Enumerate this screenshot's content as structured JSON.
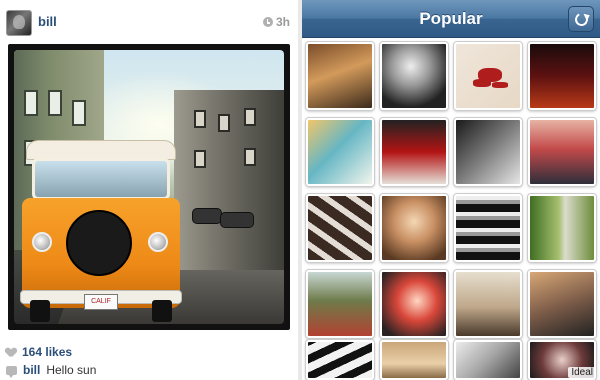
{
  "post": {
    "username": "bill",
    "time": "3h",
    "likes": "164 likes",
    "caption_user": "bill",
    "caption_text": "Hello sun",
    "plate_text": "CALIF"
  },
  "popular": {
    "title": "Popular",
    "refresh_label": "Refresh",
    "thumbs": [
      "thumb-1",
      "thumb-2",
      "thumb-3",
      "thumb-4",
      "thumb-5",
      "thumb-6",
      "thumb-7",
      "thumb-8",
      "thumb-9",
      "thumb-10",
      "thumb-11",
      "thumb-12",
      "thumb-13",
      "thumb-14",
      "thumb-15",
      "thumb-16",
      "thumb-17",
      "thumb-18",
      "thumb-19",
      "thumb-20"
    ],
    "badge_text": "Ideal"
  },
  "colors": {
    "nav_blue": "#305a86",
    "link_blue": "#2b4f7a",
    "van_orange": "#ee8a17"
  },
  "icons": {
    "clock": "clock-icon",
    "heart": "heart-icon",
    "comment": "comment-icon",
    "refresh": "refresh-icon"
  }
}
